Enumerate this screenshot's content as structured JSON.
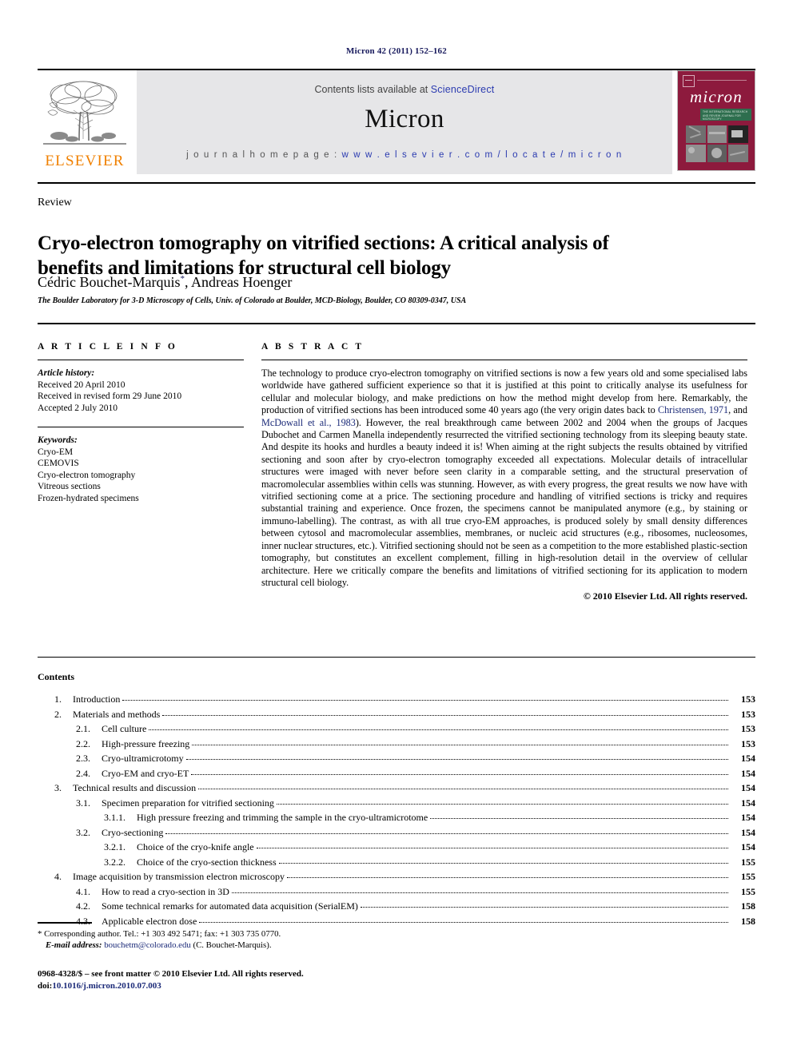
{
  "running_head": "Micron 42 (2011) 152–162",
  "header": {
    "contents_prefix": "Contents lists available at ",
    "sciencedirect": "ScienceDirect",
    "journal_name": "Micron",
    "homepage_prefix": "j o u r n a l   h o m e p a g e :  ",
    "homepage_url": "w w w . e l s e v i e r . c o m / l o c a t e / m i c r o n",
    "publisher": "ELSEVIER",
    "cover": {
      "title": "micron",
      "band_text": "THE INTERNATIONAL RESEARCH AND REVIEW JOURNAL FOR MICROSCOPY"
    },
    "colors": {
      "link": "#2b3bb0",
      "elsevier_orange": "#f08000",
      "band_gray": "#e6e6e8",
      "cover_maroon": "#8d1a3d",
      "cover_green": "#2e6e4e"
    }
  },
  "article": {
    "type": "Review",
    "title": "Cryo-electron tomography on vitrified sections: A critical analysis of benefits and limitations for structural cell biology",
    "authors": "Cédric Bouchet-Marquis",
    "authors_rest": ", Andreas Hoenger",
    "corresponding_mark": "*",
    "affiliation": "The Boulder Laboratory for 3-D Microscopy of Cells, Univ. of Colorado at Boulder, MCD-Biology, Boulder, CO 80309-0347, USA"
  },
  "article_info": {
    "heading": "A R T I C L E   I N F O",
    "history_title": "Article history:",
    "history": [
      "Received 20 April 2010",
      "Received in revised form 29 June 2010",
      "Accepted 2 July 2010"
    ],
    "keywords_title": "Keywords:",
    "keywords": [
      "Cryo-EM",
      "CEMOVIS",
      "Cryo-electron tomography",
      "Vitreous sections",
      "Frozen-hydrated specimens"
    ]
  },
  "abstract": {
    "heading": "A B S T R A C T",
    "part1": "The technology to produce cryo-electron tomography on vitrified sections is now a few years old and some specialised labs worldwide have gathered sufficient experience so that it is justified at this point to critically analyse its usefulness for cellular and molecular biology, and make predictions on how the method might develop from here. Remarkably, the production of vitrified sections has been introduced some 40 years ago (the very origin dates back to ",
    "cite1": "Christensen, 1971",
    "mid1": ", and ",
    "cite2": "McDowall et al., 1983",
    "part2": "). However, the real breakthrough came between 2002 and 2004 when the groups of Jacques Dubochet and Carmen Manella independently resurrected the vitrified sectioning technology from its sleeping beauty state. And despite its hooks and hurdles a beauty indeed it is! When aiming at the right subjects the results obtained by vitrified sectioning and soon after by cryo-electron tomography exceeded all expectations. Molecular details of intracellular structures were imaged with never before seen clarity in a comparable setting, and the structural preservation of macromolecular assemblies within cells was stunning. However, as with every progress, the great results we now have with vitrified sectioning come at a price. The sectioning procedure and handling of vitrified sections is tricky and requires substantial training and experience. Once frozen, the specimens cannot be manipulated anymore (e.g., by staining or immuno-labelling). The contrast, as with all true cryo-EM approaches, is produced solely by small density differences between cytosol and macromolecular assemblies, membranes, or nucleic acid structures (e.g., ribosomes, nucleosomes, inner nuclear structures, etc.). Vitrified sectioning should not be seen as a competition to the more established plastic-section tomography, but constitutes an excellent complement, filling in high-resolution detail in the overview of cellular architecture. Here we critically compare the benefits and limitations of vitrified sectioning for its application to modern structural cell biology.",
    "copyright": "© 2010 Elsevier Ltd. All rights reserved."
  },
  "contents": {
    "heading": "Contents",
    "entries": [
      {
        "level": 1,
        "num": "1.",
        "text": "Introduction",
        "page": "153"
      },
      {
        "level": 1,
        "num": "2.",
        "text": "Materials and methods",
        "page": "153"
      },
      {
        "level": 2,
        "num": "2.1.",
        "text": "Cell culture",
        "page": "153"
      },
      {
        "level": 2,
        "num": "2.2.",
        "text": "High-pressure freezing",
        "page": "153"
      },
      {
        "level": 2,
        "num": "2.3.",
        "text": "Cryo-ultramicrotomy",
        "page": "154"
      },
      {
        "level": 2,
        "num": "2.4.",
        "text": "Cryo-EM and cryo-ET",
        "page": "154"
      },
      {
        "level": 1,
        "num": "3.",
        "text": "Technical results and discussion",
        "page": "154"
      },
      {
        "level": 2,
        "num": "3.1.",
        "text": "Specimen preparation for vitrified sectioning",
        "page": "154"
      },
      {
        "level": 3,
        "num": "3.1.1.",
        "text": "High pressure freezing and trimming the sample in the cryo-ultramicrotome",
        "page": "154"
      },
      {
        "level": 2,
        "num": "3.2.",
        "text": "Cryo-sectioning",
        "page": "154"
      },
      {
        "level": 3,
        "num": "3.2.1.",
        "text": "Choice of the cryo-knife angle",
        "page": "154"
      },
      {
        "level": 3,
        "num": "3.2.2.",
        "text": "Choice of the cryo-section thickness",
        "page": "155"
      },
      {
        "level": 1,
        "num": "4.",
        "text": "Image acquisition by transmission electron microscopy",
        "page": "155"
      },
      {
        "level": 2,
        "num": "4.1.",
        "text": "How to read a cryo-section in 3D",
        "page": "155"
      },
      {
        "level": 2,
        "num": "4.2.",
        "text": "Some technical remarks for automated data acquisition (SerialEM)",
        "page": "158"
      },
      {
        "level": 2,
        "num": "4.3.",
        "text": "Applicable electron dose",
        "page": "158"
      }
    ]
  },
  "footnotes": {
    "corresponding": "* Corresponding author. Tel.: +1 303 492 5471; fax: +1 303 735 0770.",
    "email_label": "E-mail address:",
    "email": "bouchetm@colorado.edu",
    "email_suffix": " (C. Bouchet-Marquis)."
  },
  "imprint": {
    "line1": "0968-4328/$ – see front matter © 2010 Elsevier Ltd. All rights reserved.",
    "doi_label": "doi:",
    "doi": "10.1016/j.micron.2010.07.003"
  }
}
